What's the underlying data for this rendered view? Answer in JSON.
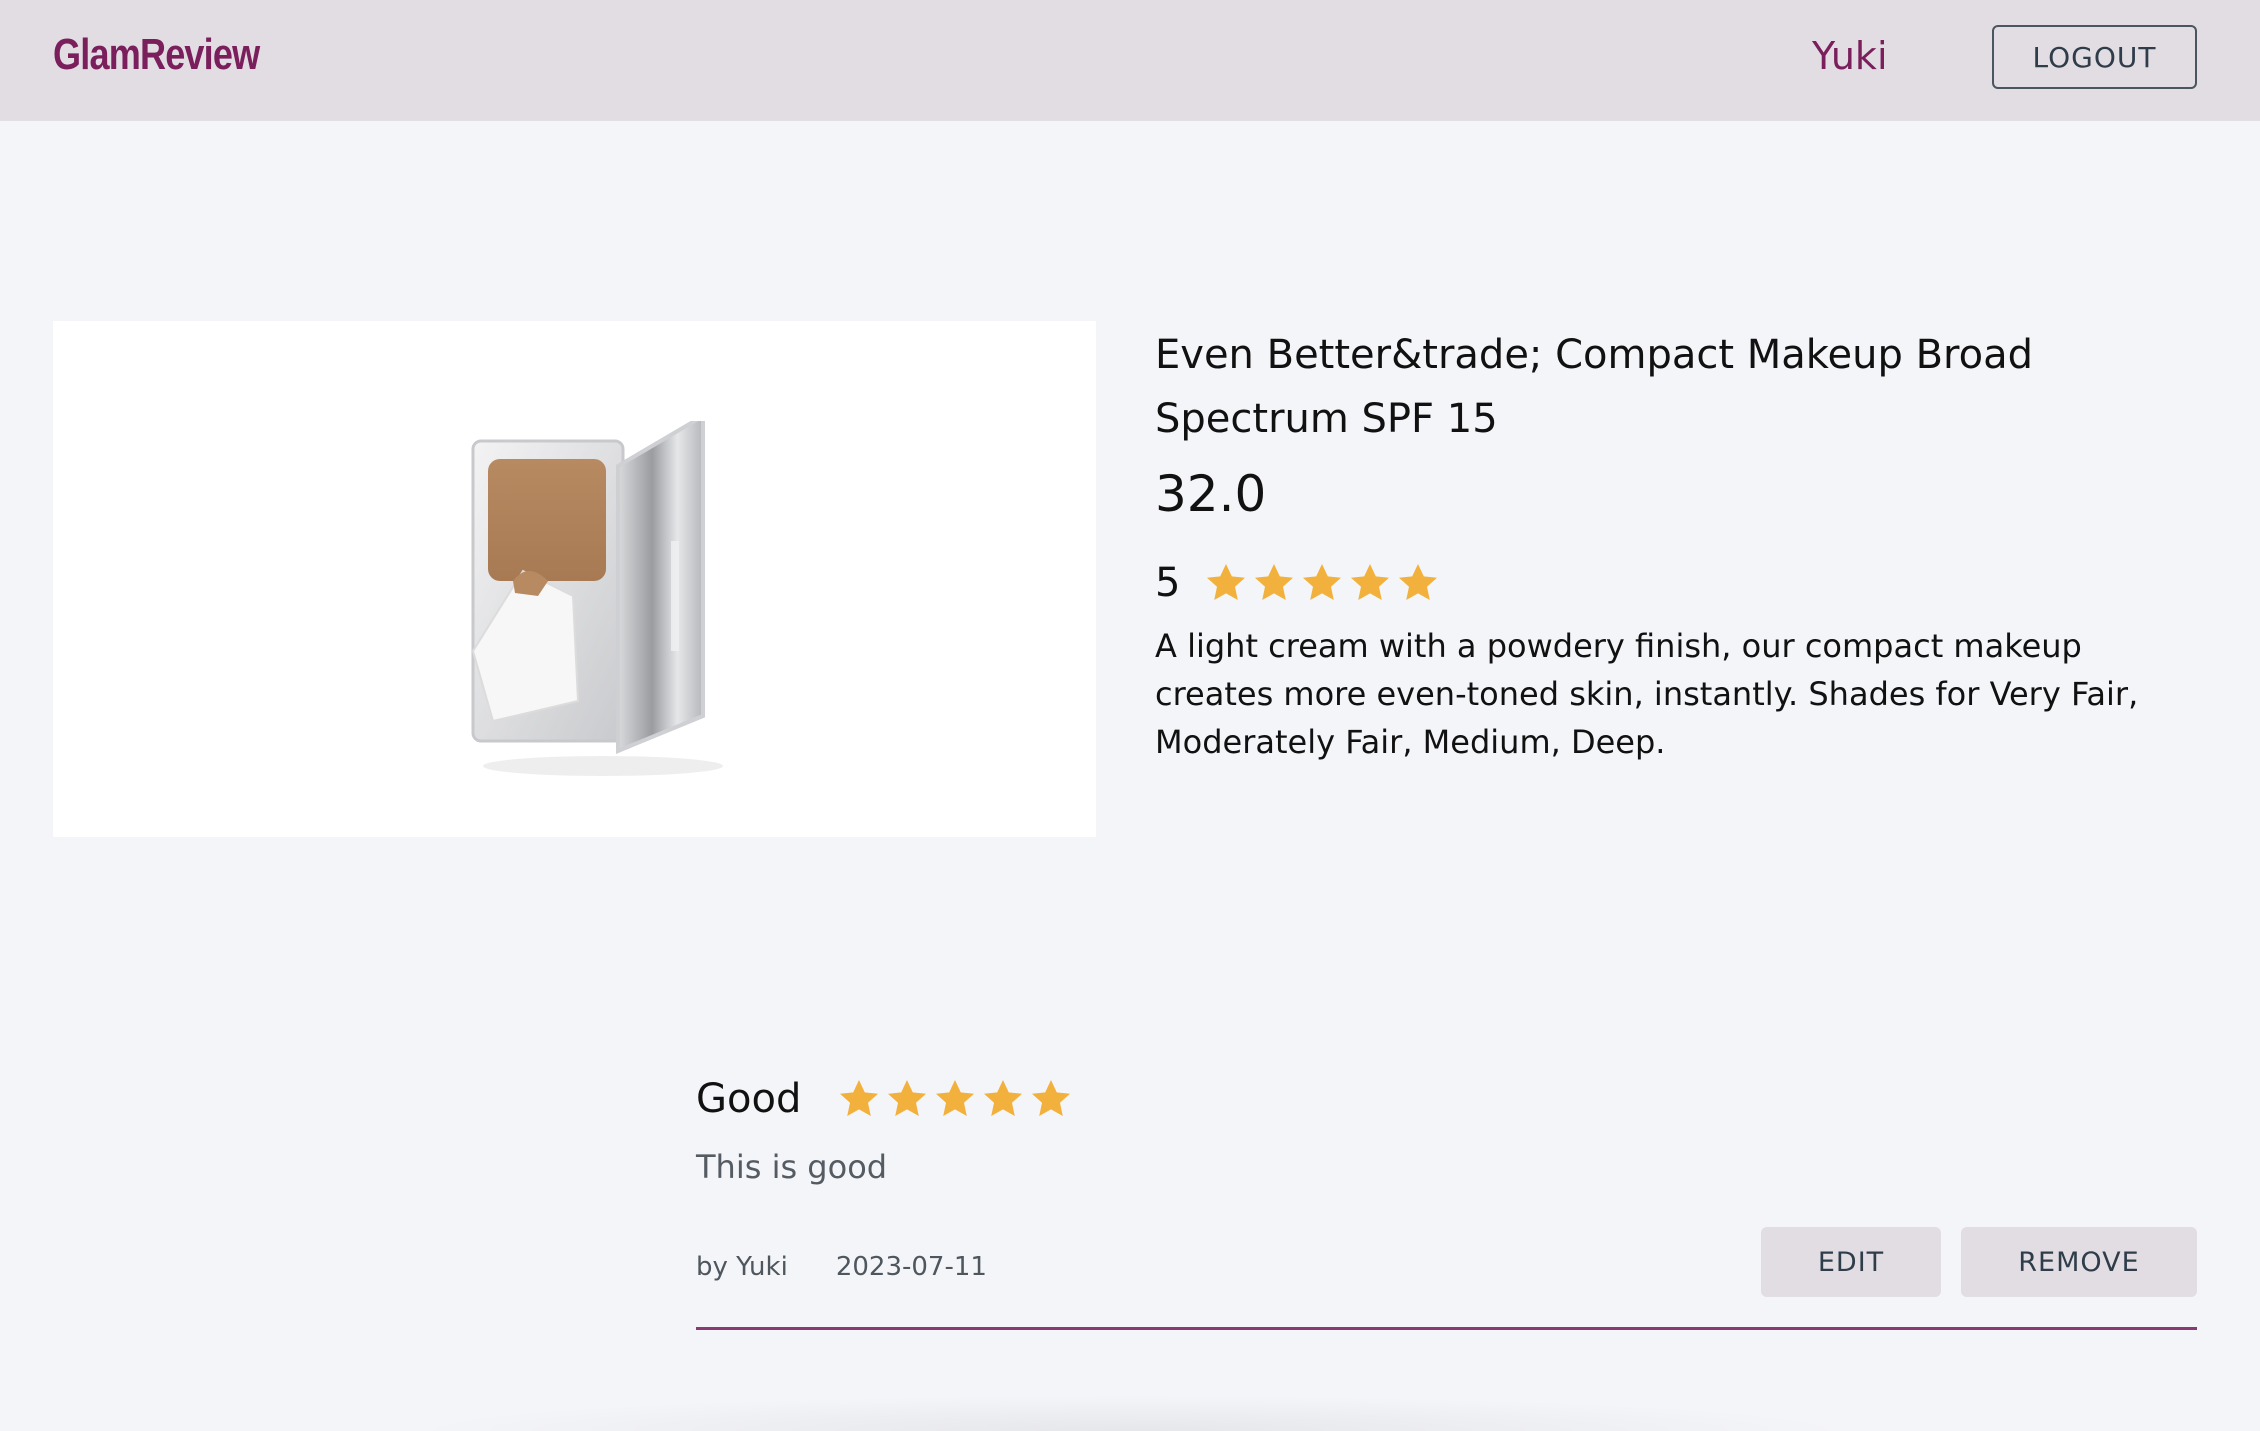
{
  "header": {
    "brand": "GlamReview",
    "username": "Yuki",
    "logout_label": "LOGOUT"
  },
  "product": {
    "image_alt": "compact makeup",
    "title": "Even Better&trade; Compact Makeup Broad Spectrum SPF 15",
    "price": "32.0",
    "rating": "5",
    "rating_stars": 5,
    "description": "A light cream with a powdery finish, our compact makeup creates more even-toned skin, instantly. Shades for Very Fair, Moderately Fair, Medium, Deep."
  },
  "review": {
    "title": "Good",
    "stars": 5,
    "text": "This is good",
    "author": "by Yuki",
    "date": "2023-07-11",
    "edit_label": "EDIT",
    "remove_label": "REMOVE"
  },
  "colors": {
    "brand": "#7a1f5c",
    "star": "#f2b13c",
    "topbar": "#e1dde3",
    "background": "#f4f5f9"
  },
  "icons": {
    "star": "star-icon"
  }
}
